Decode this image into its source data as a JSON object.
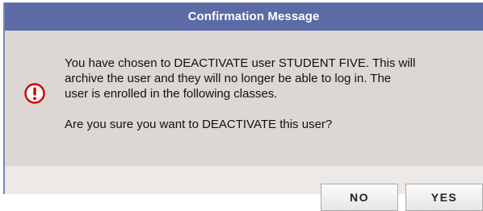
{
  "dialog": {
    "title": "Confirmation Message",
    "icon": "alert-circle-icon",
    "icon_color": "#d10000",
    "title_bg": "#5c6aa6",
    "message_lines": [
      "You have chosen to DEACTIVATE user STUDENT FIVE. This will",
      "archive the user and they will no longer be able to log in. The",
      "user is enrolled in the following classes."
    ],
    "question": "Are you sure you want to DEACTIVATE this user?",
    "buttons": {
      "no": "NO",
      "yes": "YES"
    }
  }
}
